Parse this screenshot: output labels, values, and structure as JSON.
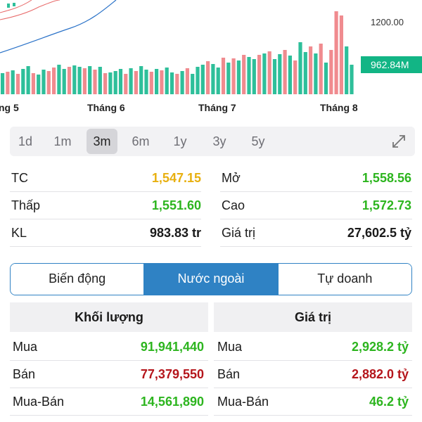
{
  "chart": {
    "price_label": "1200.00",
    "volume_badge": "962.84M",
    "months": [
      "ng 5",
      "Tháng 6",
      "Tháng 7",
      "Tháng 8"
    ],
    "colors": {
      "up": "#2ebf9a",
      "down": "#f08b8f",
      "line": "#2a72c8",
      "band": "#e86a6a"
    }
  },
  "range": {
    "options": [
      "1d",
      "1m",
      "3m",
      "6m",
      "1y",
      "3y",
      "5y"
    ],
    "selected": "3m"
  },
  "stats": {
    "tc": {
      "label": "TC",
      "value": "1,547.15",
      "color": "#e8b010"
    },
    "mo": {
      "label": "Mở",
      "value": "1,558.56",
      "color": "#2db51f"
    },
    "thap": {
      "label": "Thấp",
      "value": "1,551.60",
      "color": "#2db51f"
    },
    "cao": {
      "label": "Cao",
      "value": "1,572.73",
      "color": "#2db51f"
    },
    "kl": {
      "label": "KL",
      "value": "983.83 tr",
      "color": "#1a1a1a"
    },
    "giatri": {
      "label": "Giá trị",
      "value": "27,602.5 tỷ",
      "color": "#1a1a1a"
    }
  },
  "tabs": [
    "Biến động",
    "Nước ngoài",
    "Tự doanh"
  ],
  "active_tab": "Nước ngoài",
  "foreign": {
    "volume_header": "Khối lượng",
    "value_header": "Giá trị",
    "rows": [
      {
        "label": "Mua",
        "volume": "91,941,440",
        "value": "2,928.2 tỷ",
        "color": "#2db51f"
      },
      {
        "label": "Bán",
        "volume": "77,379,550",
        "value": "2,882.0 tỷ",
        "color": "#b5161c"
      },
      {
        "label": "Mua-Bán",
        "volume": "14,561,890",
        "value": "46.2 tỷ",
        "color": "#2db51f"
      }
    ]
  }
}
